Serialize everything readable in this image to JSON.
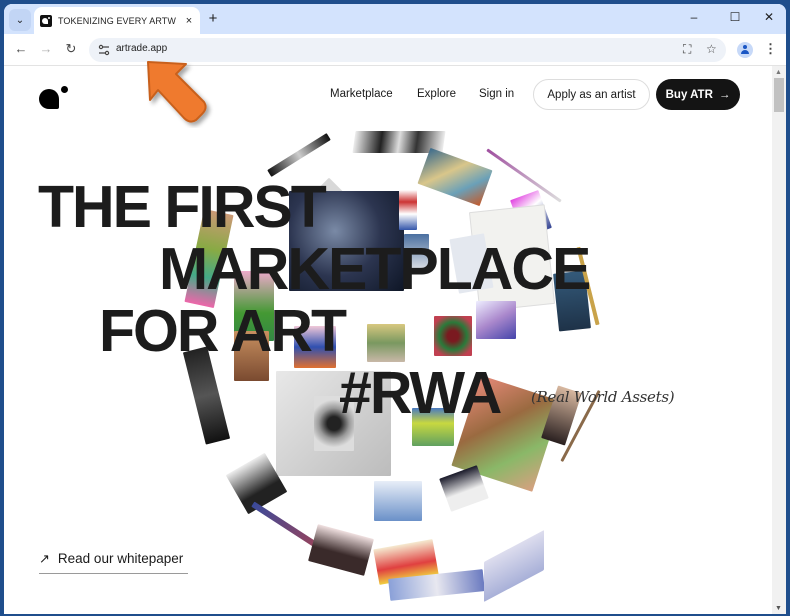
{
  "browser": {
    "tab": {
      "title": "TOKENIZING EVERY ARTWORK",
      "close_icon": "×"
    },
    "tab_search_icon": "⌄",
    "new_tab_icon": "+",
    "window_controls": {
      "minimize": "–",
      "maximize": "☐",
      "close": "✕"
    },
    "nav": {
      "back": "←",
      "forward": "→",
      "reload": "↻"
    },
    "url": "artrade.app",
    "translate_icon": "⛶",
    "bookmark_icon": "☆",
    "menu_icon": "⋮"
  },
  "page": {
    "nav_links": [
      "Marketplace",
      "Explore",
      "Sign in"
    ],
    "apply_button": "Apply as an artist",
    "buy_button": "Buy ATR",
    "buy_arrow": "→",
    "headline": {
      "line1": "THE FIRST",
      "line2": "MARKETPLACE",
      "line3": "FOR ART",
      "line4": "#RWA"
    },
    "subline": "(Real World Assets)",
    "whitepaper_icon": "↗",
    "whitepaper_link": "Read our whitepaper"
  },
  "colors": {
    "accent_dark": "#141414",
    "callout_arrow": "#ef7a2d"
  }
}
